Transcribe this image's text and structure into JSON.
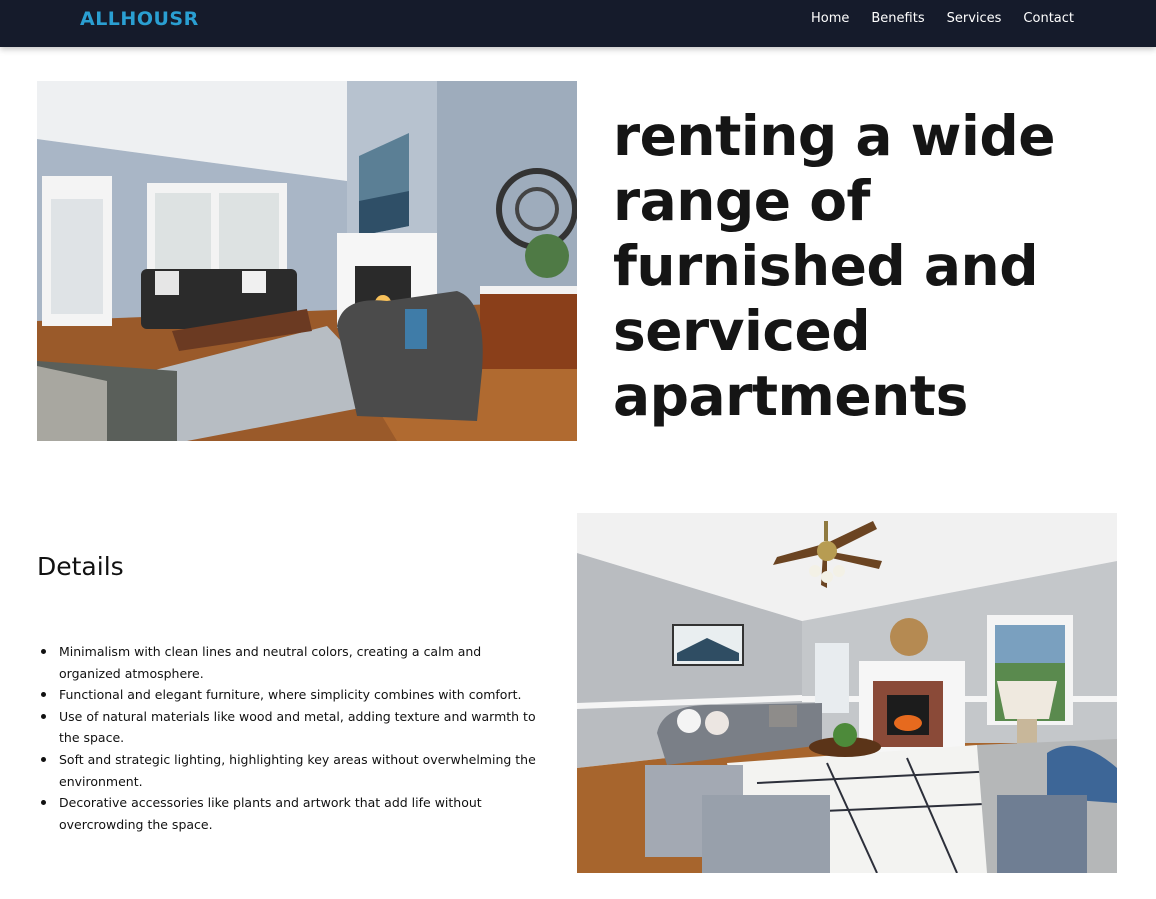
{
  "nav": {
    "brand": "ALLHOUSR",
    "links": [
      "Home",
      "Benefits",
      "Services",
      "Contact"
    ]
  },
  "hero": {
    "headline": "renting a wide range of furnished and serviced apartments"
  },
  "details": {
    "title": "Details",
    "items": [
      "Minimalism with clean lines and neutral colors, creating a calm and organized atmosphere.",
      "Functional and elegant furniture, where simplicity combines with comfort.",
      "Use of natural materials like wood and metal, adding texture and warmth to the space.",
      "Soft and strategic lighting, highlighting key areas without overwhelming the environment.",
      "Decorative accessories like plants and artwork that add life without overcrowding the space."
    ]
  },
  "colors": {
    "navbar_bg": "#151b2b",
    "brand": "#2a9fd2",
    "text": "#111111"
  }
}
